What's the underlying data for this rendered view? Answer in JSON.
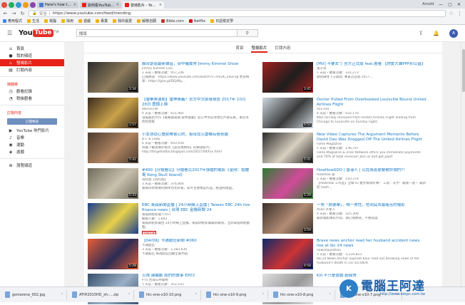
{
  "browser": {
    "tabs": [
      {
        "label": "Here's how to activate",
        "color": "#4a7bd0",
        "active": false
      },
      {
        "label": "如何看YouTube上影片",
        "color": "#e62117",
        "active": false
      },
      {
        "label": "發燒影片 - YouTube",
        "color": "#e62117",
        "active": true
      }
    ],
    "user": "Arnold",
    "url_secure": "安全",
    "url": "https://www.youtube.com/feed/trending",
    "bookmarks": [
      {
        "label": "應用程式",
        "color": "#4285f4"
      },
      {
        "label": "生活",
        "color": "#f4b400"
      },
      {
        "label": "電腦",
        "color": "#f4b400"
      },
      {
        "label": "採用",
        "color": "#f4b400"
      },
      {
        "label": "遊戲",
        "color": "#f4b400"
      },
      {
        "label": "專業",
        "color": "#f4b400"
      },
      {
        "label": "我的最愛",
        "color": "#f4b400"
      },
      {
        "label": "解散自願",
        "color": "#f4b400"
      },
      {
        "label": "Bible.com",
        "color": "#c0392b"
      },
      {
        "label": "Netflix",
        "color": "#e50914"
      },
      {
        "label": "日語檢定學",
        "color": "#f4b400"
      }
    ]
  },
  "header": {
    "logo_you": "You",
    "logo_tube": "Tube",
    "logo_region": "TW",
    "search_placeholder": "搜尋",
    "avatar_letter": "A"
  },
  "sidebar": {
    "items": [
      {
        "label": "首頁",
        "icon": "home-icon",
        "glyph": "⌂",
        "active": false
      },
      {
        "label": "我的頻道",
        "icon": "person-icon",
        "glyph": "●",
        "active": false
      },
      {
        "label": "發燒影片",
        "icon": "flame-icon",
        "glyph": "♨",
        "active": true
      },
      {
        "label": "訂閱內容",
        "icon": "subscriptions-icon",
        "glyph": "▤",
        "active": false
      }
    ],
    "library_title": "媒體庫",
    "library": [
      {
        "label": "觀看記錄",
        "icon": "history-icon",
        "glyph": "◷"
      },
      {
        "label": "稍後觀看",
        "icon": "clock-icon",
        "glyph": "◔"
      }
    ],
    "subs_title": "訂閱內容",
    "subs_button": "訂閱頻道",
    "subs": [
      {
        "label": "YouTube 熱門影片",
        "icon": "play-icon",
        "glyph": "▶"
      },
      {
        "label": "音樂",
        "icon": "music-icon",
        "glyph": "♪"
      },
      {
        "label": "運動",
        "icon": "sport-icon",
        "glyph": "◉"
      },
      {
        "label": "遊戲",
        "icon": "gamepad-icon",
        "glyph": "◈"
      }
    ],
    "browse": {
      "label": "瀏覽頻道",
      "icon": "plus-circle-icon",
      "glyph": "⊕"
    }
  },
  "content_tabs": [
    {
      "label": "首頁",
      "active": false
    },
    {
      "label": "發燒影片",
      "active": true
    },
    {
      "label": "訂閱內容",
      "active": false
    }
  ],
  "videos_left": [
    {
      "title": "聯合創造最新聲音，台中羅蘭秀 Jimmy Kimmel Show",
      "channel": "Jimmy Kimmel Live",
      "meta": "3 天前・觀看次數：957,236",
      "desc": "訂閱頻道：https://www.youtube.com/watch?v=HV2K_ERuFog\n更多精采：https://goo.gl/DEJ4Ky...",
      "duration": "3:34",
      "colors": [
        "#2b2b2b",
        "#8c7a5a"
      ],
      "badge": ""
    },
    {
      "title": "【電擊奧運期】雷神奧義？官方中文前導預告 2017年 10月 28日 震撼上映",
      "channel": "MarvelTW",
      "meta": "4 天前・觀看次數：621,981",
      "desc": "漫威最新力作【電擊奧運期 雷神奧義】官方中文前導預告片搶先看，東尼等你的到來",
      "duration": "1:57",
      "colors": [
        "#3a2a1e",
        "#c9a24a"
      ],
      "badge": ""
    },
    {
      "title": "小女孩從心豐割樂嘗心的，祖母竟又慶機有極奇趣",
      "channel": "B.C & Lowy",
      "meta": "6 天前・觀看次數：693,939",
      "desc": "有趣下載語爆炸搞笑【美化視頻系】的精選影片。\nhttp://forgetlistbo.blogspot.com/2017/04/fun.html",
      "duration": "5:42",
      "colors": [
        "#4a3b2f",
        "#b08560"
      ],
      "badge": ""
    },
    {
      "title": "#490【分鐘看完】分鐘看完2017年強檔的電影《金剛：骷髏島 Kong Skull Island》",
      "channel": "谷阿莫【谷阿莫】",
      "meta": "3 天前・觀看次數：376,806",
      "desc": "看看同學想要的精準也太好看，影片主要像是作品，經過和裡面。",
      "duration": "5:33",
      "colors": [
        "#6f6a5a",
        "#c8c1ad"
      ],
      "badge": ""
    },
    {
      "title": "EBC 東森新聞直播 | 24小時線上直播 | Taiwan EBC 24h live finance news | 台灣 EBC 金融新聞 24",
      "channel": "東森財經新聞 CH57",
      "meta": "觀看人數：1,843",
      "desc": "東森財經新聞台 24小時線上直播，東森財經新聞最新最快，立即掌握財經動態。",
      "duration": "",
      "colors": [
        "#1b3e8f",
        "#e7d14a"
      ],
      "badge": "現場直播"
    },
    {
      "title": "【04/09】卡通超狂新聞 #060",
      "channel": "卡通超狂",
      "meta": "3 天前・觀看次數：1,283,630",
      "desc": "卡通超狂 每週超狂回顧全部內容",
      "duration": "5:28",
      "colors": [
        "#e85d36",
        "#2c2c54"
      ],
      "badge": ""
    },
    {
      "title": "公視 連續劇 我們的故事 EP03",
      "channel": "PTS 台灣公共電視",
      "meta": "5 天前・觀看次數：352,102",
      "desc": "",
      "duration": "",
      "colors": [
        "#38506b",
        "#9bb0c7"
      ],
      "badge": ""
    }
  ],
  "videos_right": [
    {
      "title": "[MV] 不要去ㄅ 官方正式版 feat.著著 【妳愛大聲PPP別公益】",
      "channel": "蛋子哥",
      "meta": "1 天前・觀看次數：331,273",
      "desc": "歌詞請往下方歌詞.\n專拿這首歌 2017...",
      "duration": "3:45",
      "colors": [
        "#a32020",
        "#1e1e1e"
      ],
      "badge": ""
    },
    {
      "title": "Doctor Pulled From Overbooked Louisville Bound United Airlines Flight",
      "channel": "xxx xxx",
      "meta": "4 天前・觀看次數：632,176",
      "desc": "Man forcibly removed from United Airlines Flight leading from Chicago to Louisville on Sunday night.",
      "duration": "0:52",
      "colors": [
        "#cfd8e0",
        "#3a3a3a"
      ],
      "badge": ""
    },
    {
      "title": "New Video Captures The Argument Moments Before David Dao Was Dragged Off The United Airlines Flight",
      "channel": "Fame Magazine",
      "meta": "5 天前・觀看次數：136,747",
      "desc": "Fame Magazine & iFree Network offers you immediate payments and 70% of total revenue! Join us and get paid!",
      "duration": "5:41",
      "colors": [
        "#2a2a2a",
        "#d8cfc0"
      ],
      "badge": ""
    },
    {
      "title": "HowHowSDO | 香港人 | 究竟為甚麼要被評價們?!",
      "channel": "HowHow 豪",
      "meta": "1 天前・觀看次數：210,374",
      "desc": "【HowHow 工作室】全線 IG 推文報導好事！\n工具：天宇：最後一週 ！最新的 hooh...",
      "duration": "5:29",
      "colors": [
        "#2e7d32",
        "#d14a9a"
      ],
      "badge": ""
    },
    {
      "title": "一男「劉德華」，唯一男性，吃到底去最痛苦的電影",
      "channel": "Alien 外星人",
      "meta": "4 天前・觀看次數：325,306",
      "desc": "最新電影精彩片段，請訂閱頻道，不要錯過",
      "duration": "3:59",
      "colors": [
        "#3a2f2a",
        "#b38d74"
      ],
      "badge": ""
    },
    {
      "title": "Brave news anchor read her husband accident news live at ibc 24 news",
      "channel": "newsRajasthan",
      "meta": "3 天前・觀看次數：5,234,823",
      "desc": "IBC24 News Anchor Supreet Kaur read out breaking news of her husband's death in car accident",
      "duration": "0:58",
      "colors": [
        "#0d2a6b",
        "#c33"
      ],
      "badge": ""
    },
    {
      "title": "Kill 不只是遊戲 超痛快",
      "channel": "",
      "meta": "",
      "desc": "",
      "duration": "",
      "colors": [
        "#e0e0e0",
        "#999"
      ],
      "badge": ""
    }
  ],
  "downloads": [
    {
      "label": "gsmarena_002.jpg"
    },
    {
      "label": "ATIH2015HD_zh-....zip"
    },
    {
      "label": "htc-one-x10-10.png"
    },
    {
      "label": "htc-one-x10-9.png"
    },
    {
      "label": "htc-one-x10-8.png"
    },
    {
      "label": "htc-one-x10-7.png"
    }
  ],
  "watermark": {
    "logo": "K",
    "text": "電腦王阿達",
    "url": "http://www.kocpc.com.tw"
  }
}
